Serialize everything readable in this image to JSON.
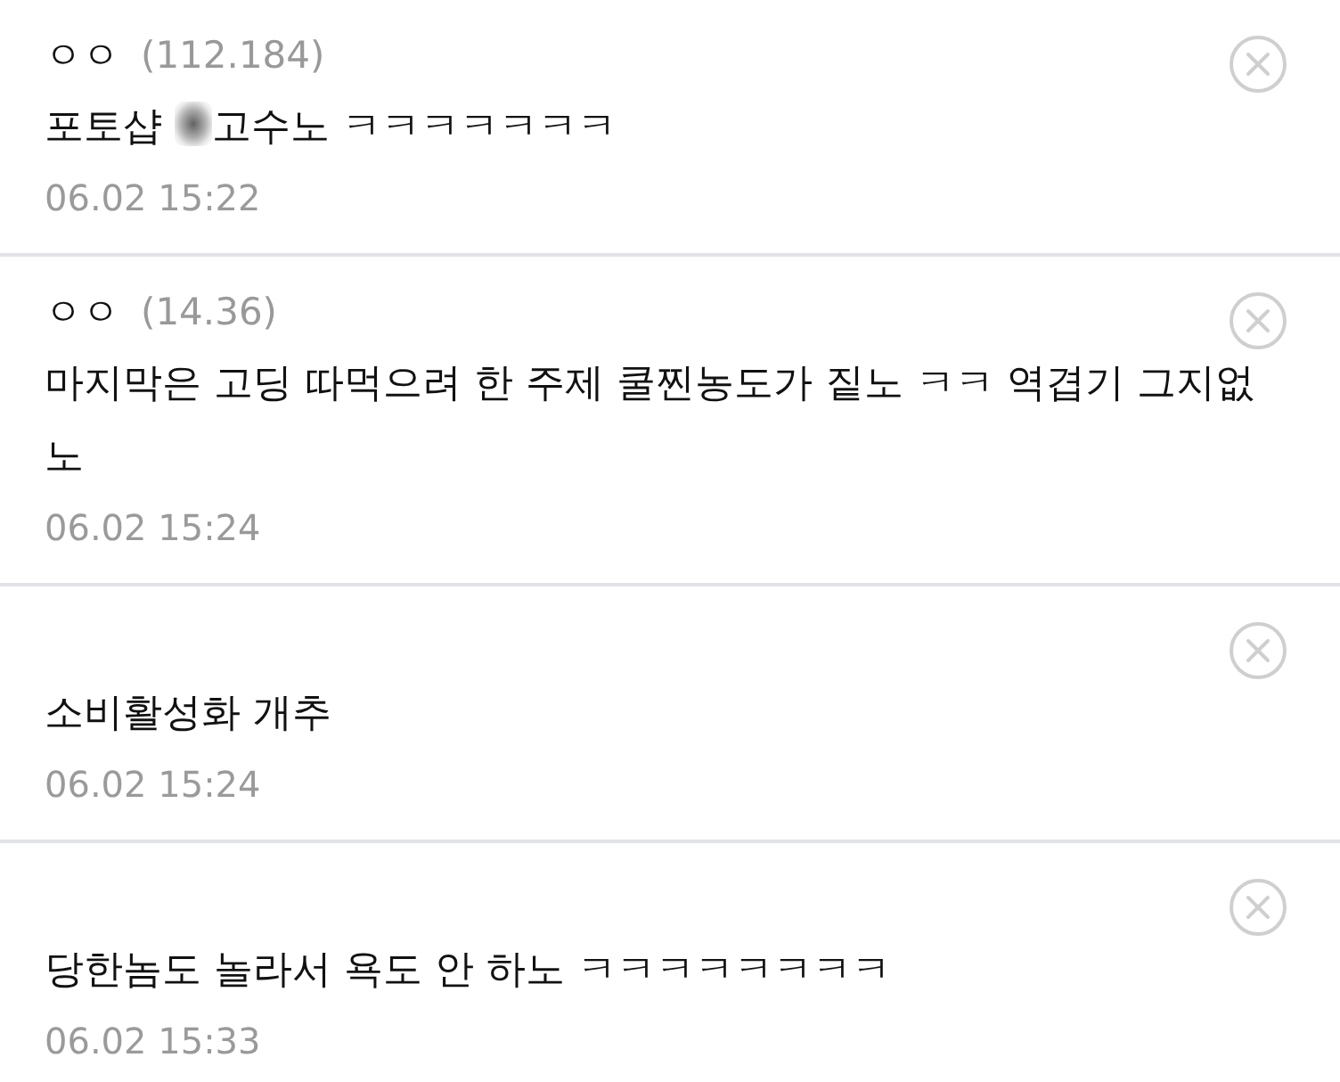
{
  "comments": [
    {
      "author": {
        "name": "ㅇㅇ",
        "ip": "(112.184)"
      },
      "body": [
        {
          "kind": "text",
          "text": "포토샵"
        },
        {
          "kind": "blur"
        },
        {
          "kind": "text",
          "text": "고수노 ㅋㅋㅋㅋㅋㅋㅋ"
        }
      ],
      "time": "06.02 15:22"
    },
    {
      "author": {
        "name": "ㅇㅇ",
        "ip": "(14.36)"
      },
      "body": [
        {
          "kind": "text",
          "text": "마지막은 고딩 따먹으려 한 주제 쿨찐농도가 짙노 ㅋㅋ 역겹기 그지없노"
        }
      ],
      "time": "06.02 15:24"
    },
    {
      "body": [
        {
          "kind": "text",
          "text": "소비활성화 개추"
        }
      ],
      "time": "06.02 15:24"
    },
    {
      "body": [
        {
          "kind": "text",
          "text": "당한놈도 놀라서 욕도 안 하노 ㅋㅋㅋㅋㅋㅋㅋㅋ"
        }
      ],
      "time": "06.02 15:33"
    }
  ]
}
